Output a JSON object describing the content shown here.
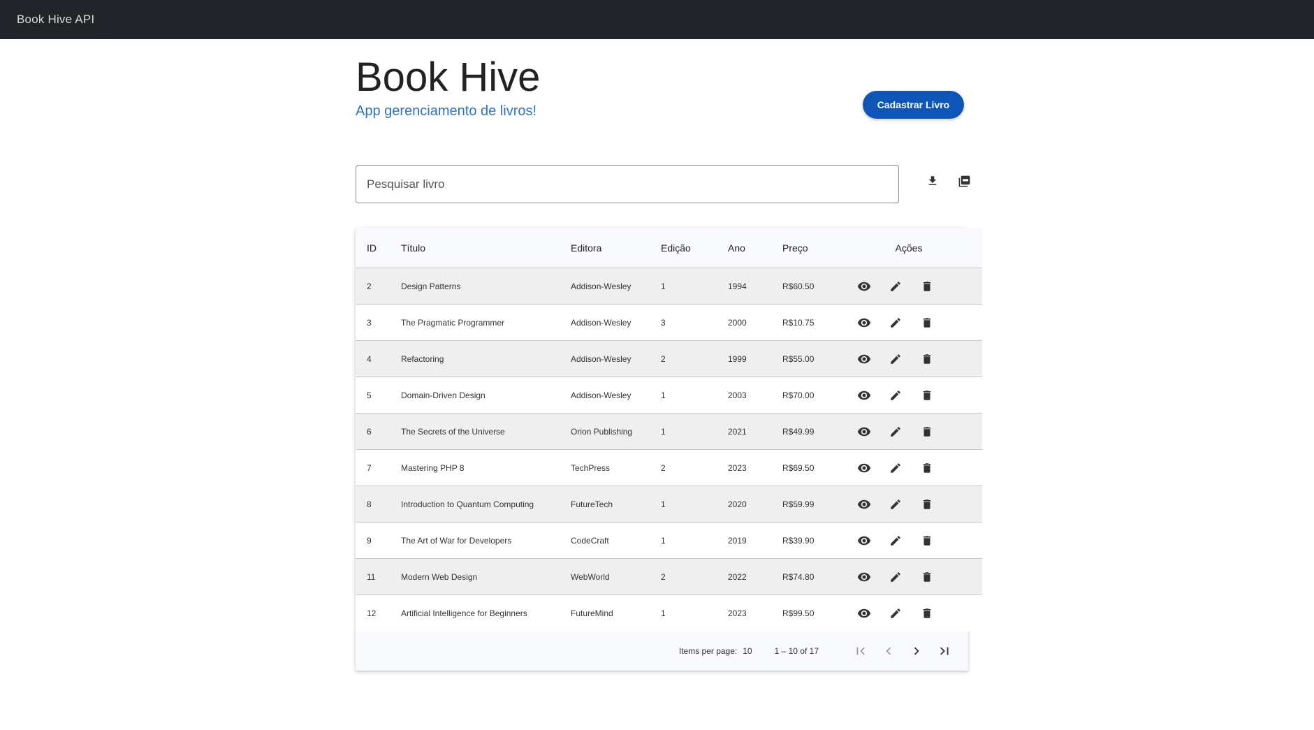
{
  "app": {
    "title": "Book Hive API"
  },
  "header": {
    "title": "Book Hive",
    "subtitle": "App gerenciamento de livros!",
    "register_button": "Cadastrar Livro"
  },
  "search": {
    "placeholder": "Pesquisar livro",
    "value": ""
  },
  "toolbar": {
    "icons": [
      "download-icon",
      "pdf-icon"
    ]
  },
  "table": {
    "columns": [
      "ID",
      "Título",
      "Editora",
      "Edição",
      "Ano",
      "Preço",
      "Ações"
    ],
    "rows": [
      {
        "id": "2",
        "title": "Design Patterns",
        "publisher": "Addison-Wesley",
        "edition": "1",
        "year": "1994",
        "price": "R$60.50"
      },
      {
        "id": "3",
        "title": "The Pragmatic Programmer",
        "publisher": "Addison-Wesley",
        "edition": "3",
        "year": "2000",
        "price": "R$10.75"
      },
      {
        "id": "4",
        "title": "Refactoring",
        "publisher": "Addison-Wesley",
        "edition": "2",
        "year": "1999",
        "price": "R$55.00"
      },
      {
        "id": "5",
        "title": "Domain-Driven Design",
        "publisher": "Addison-Wesley",
        "edition": "1",
        "year": "2003",
        "price": "R$70.00"
      },
      {
        "id": "6",
        "title": "The Secrets of the Universe",
        "publisher": "Orion Publishing",
        "edition": "1",
        "year": "2021",
        "price": "R$49.99"
      },
      {
        "id": "7",
        "title": "Mastering PHP 8",
        "publisher": "TechPress",
        "edition": "2",
        "year": "2023",
        "price": "R$69.50"
      },
      {
        "id": "8",
        "title": "Introduction to Quantum Computing",
        "publisher": "FutureTech",
        "edition": "1",
        "year": "2020",
        "price": "R$59.99"
      },
      {
        "id": "9",
        "title": "The Art of War for Developers",
        "publisher": "CodeCraft",
        "edition": "1",
        "year": "2019",
        "price": "R$39.90"
      },
      {
        "id": "11",
        "title": "Modern Web Design",
        "publisher": "WebWorld",
        "edition": "2",
        "year": "2022",
        "price": "R$74.80"
      },
      {
        "id": "12",
        "title": "Artificial Intelligence for Beginners",
        "publisher": "FutureMind",
        "edition": "1",
        "year": "2023",
        "price": "R$99.50"
      }
    ],
    "row_actions": [
      "view-icon",
      "edit-icon",
      "delete-icon"
    ]
  },
  "paginator": {
    "items_per_page_label": "Items per page:",
    "items_per_page": "10",
    "range": "1 – 10 of 17"
  },
  "colors": {
    "topbar": "#212529",
    "primary": "#0d56b8",
    "subtitle": "#2e72c3",
    "row_alt": "#efefef"
  }
}
